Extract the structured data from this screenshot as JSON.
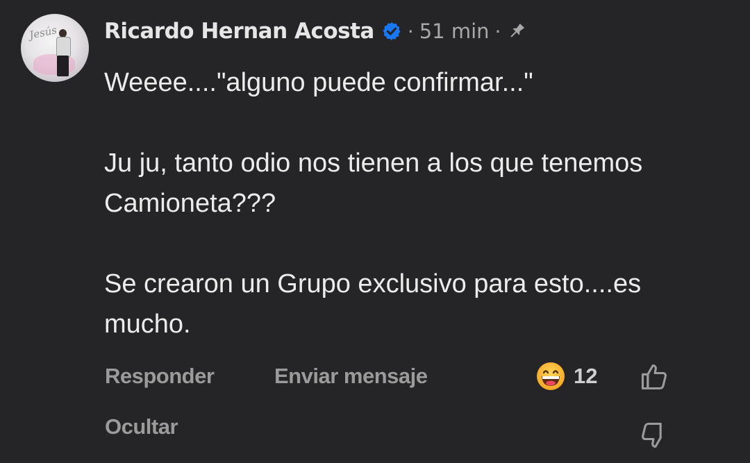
{
  "comment": {
    "author": "Ricardo Hernan Acosta",
    "separator_1": "·",
    "time": "51 min",
    "separator_2": "·",
    "avatar_logo": "Jesús",
    "paragraphs": [
      "Weeee....\"alguno puede confirmar...\"",
      "Ju ju, tanto odio nos tienen a los que tenemos Camioneta???",
      "Se crearon un Grupo exclusivo para esto....es mucho."
    ]
  },
  "actions": {
    "reply": "Responder",
    "send_message": "Enviar mensaje",
    "hide": "Ocultar",
    "reaction_count": "12",
    "reaction_emoji": "grinning-face-emoji"
  },
  "icons": {
    "verified": "verified-badge-icon",
    "pin": "pin-icon",
    "like": "thumbs-up-icon",
    "dislike": "thumbs-down-icon"
  },
  "colors": {
    "background": "#252527",
    "verified": "#1877f2",
    "author": "#e6e6e6",
    "muted": "#9b9b9b"
  }
}
